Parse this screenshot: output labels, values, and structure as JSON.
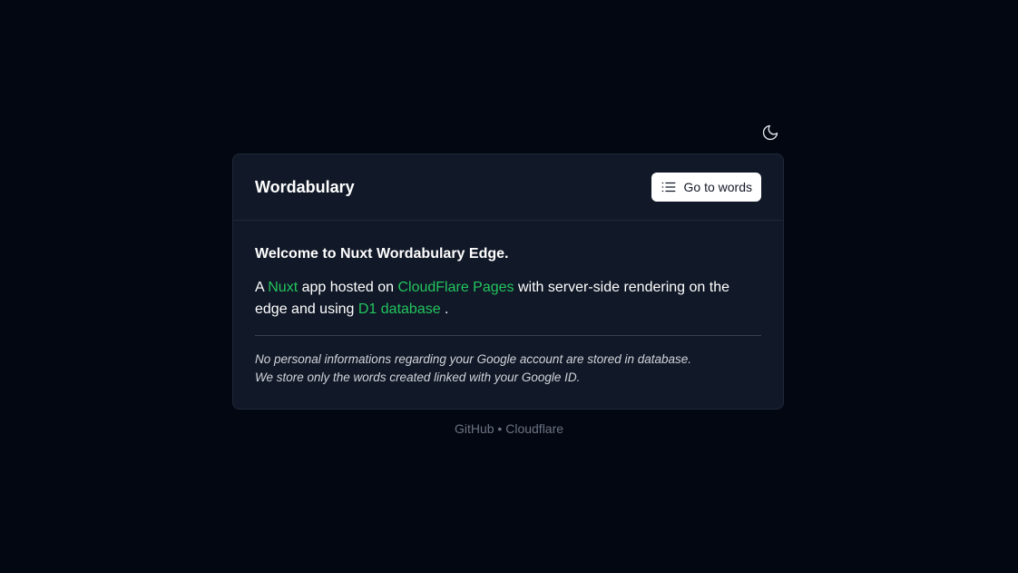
{
  "header": {
    "theme_toggle_icon": "moon-icon"
  },
  "card": {
    "title": "Wordabulary",
    "go_button": {
      "label": "Go to words",
      "icon": "list-icon"
    },
    "welcome": "Welcome to Nuxt Wordabulary Edge.",
    "description": {
      "prefix": "A ",
      "link1": "Nuxt",
      "text1": " app hosted on ",
      "link2": "CloudFlare Pages",
      "text2": " with server-side rendering on the edge and using ",
      "link3": "D1 database",
      "suffix": " ."
    },
    "note_line1": "No personal informations regarding your Google account are stored in database.",
    "note_line2": "We store only the words created linked with your Google ID."
  },
  "footer": {
    "link1": "GitHub",
    "separator": "•",
    "link2": "Cloudflare"
  },
  "colors": {
    "background": "#030712",
    "card": "#111827",
    "accent": "#22c55e"
  }
}
